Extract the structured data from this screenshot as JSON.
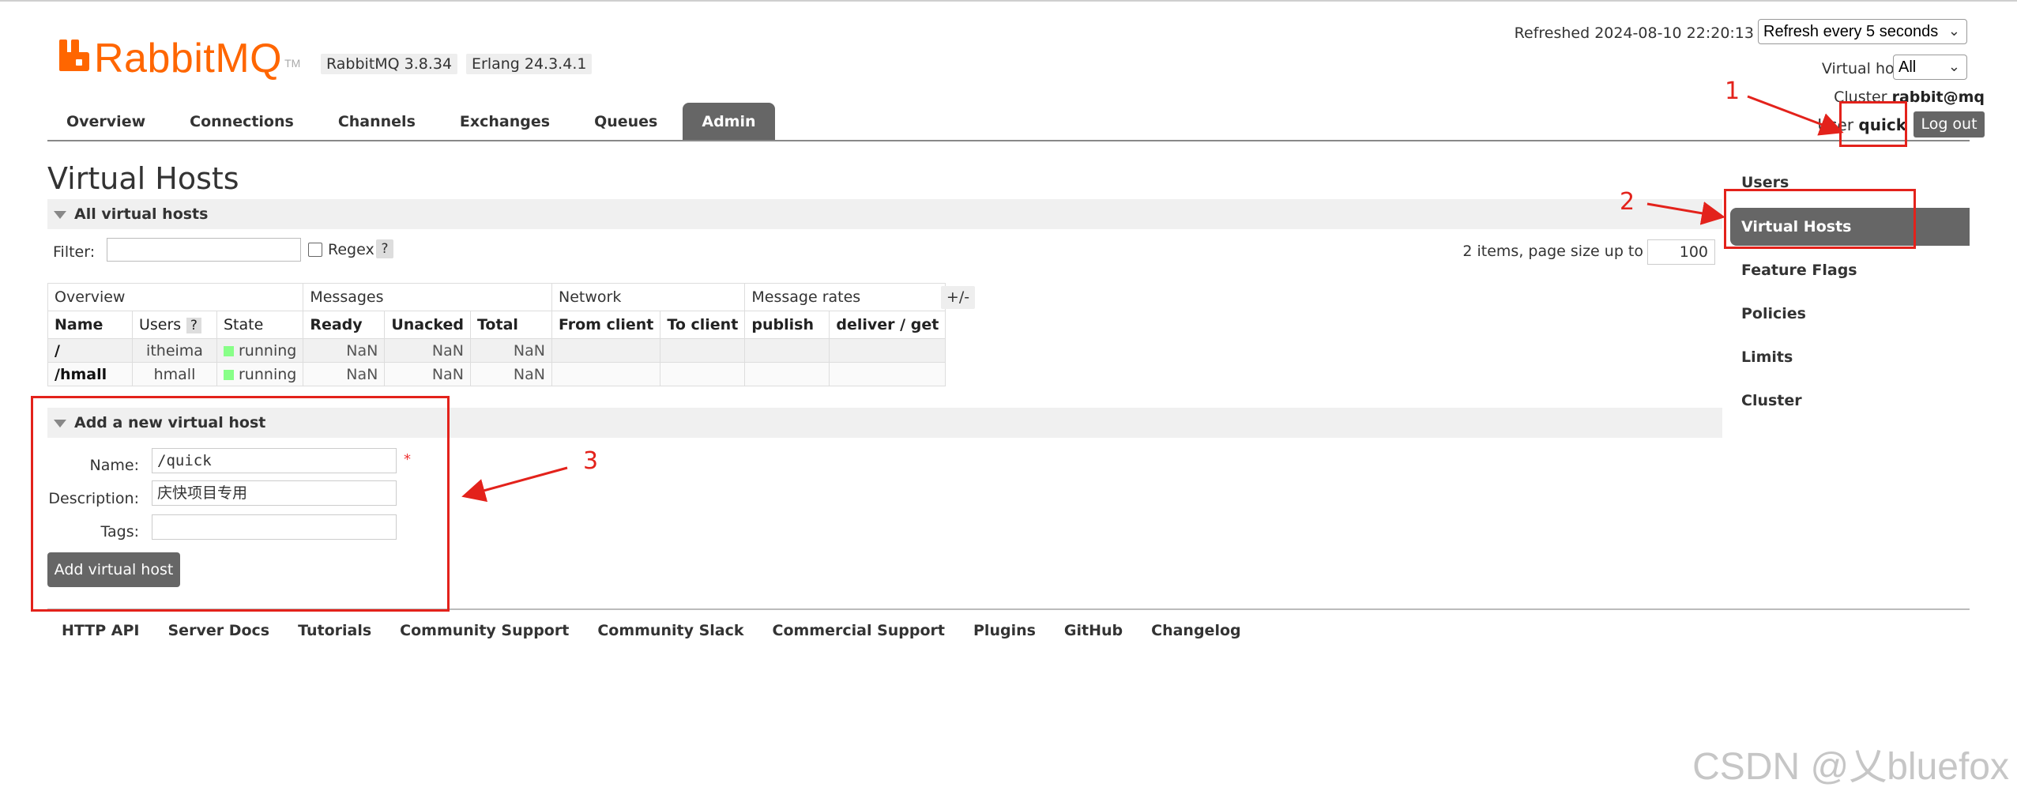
{
  "app": {
    "logo_text": "RabbitMQ",
    "logo_tm": "TM",
    "version": "RabbitMQ 3.8.34",
    "erlang": "Erlang 24.3.4.1"
  },
  "top_right": {
    "refreshed": "Refreshed 2024-08-10 22:20:13",
    "refresh_select": "Refresh every 5 seconds",
    "vhost_label": "Virtual host",
    "vhost_select": "All",
    "cluster_label": "Cluster",
    "cluster_value": "rabbit@mq",
    "user_label": "User",
    "user_value": "quick",
    "logout": "Log out"
  },
  "tabs": [
    "Overview",
    "Connections",
    "Channels",
    "Exchanges",
    "Queues",
    "Admin"
  ],
  "active_tab": "Admin",
  "page": {
    "title": "Virtual Hosts",
    "section_all": "All virtual hosts",
    "filter_label": "Filter:",
    "regex_label": "Regex",
    "help": "?",
    "items_text": "2 items, page size up to",
    "page_size": "100",
    "plus_minus": "+/-"
  },
  "table": {
    "groups": [
      "Overview",
      "Messages",
      "Network",
      "Message rates"
    ],
    "headers": [
      "Name",
      "Users",
      "State",
      "Ready",
      "Unacked",
      "Total",
      "From client",
      "To client",
      "publish",
      "deliver / get"
    ],
    "rows": [
      {
        "name": "/",
        "users": "itheima",
        "state": "running",
        "ready": "NaN",
        "unacked": "NaN",
        "total": "NaN"
      },
      {
        "name": "/hmall",
        "users": "hmall",
        "state": "running",
        "ready": "NaN",
        "unacked": "NaN",
        "total": "NaN"
      }
    ]
  },
  "add_form": {
    "section": "Add a new virtual host",
    "name_label": "Name:",
    "name_value": "/quick",
    "required_mark": "*",
    "desc_label": "Description:",
    "desc_value": "庆快项目专用",
    "tags_label": "Tags:",
    "tags_value": "",
    "submit": "Add virtual host"
  },
  "right_nav": [
    "Users",
    "Virtual Hosts",
    "Feature Flags",
    "Policies",
    "Limits",
    "Cluster"
  ],
  "right_nav_active": "Virtual Hosts",
  "footer": [
    "HTTP API",
    "Server Docs",
    "Tutorials",
    "Community Support",
    "Community Slack",
    "Commercial Support",
    "Plugins",
    "GitHub",
    "Changelog"
  ],
  "annotations": [
    "1",
    "2",
    "3"
  ],
  "watermark": "CSDN @乂bluefox",
  "colors": {
    "brand_orange": "#ff6600",
    "dark_gray": "#666666",
    "annotation_red": "#e3221b",
    "running_green": "#88ff88"
  }
}
